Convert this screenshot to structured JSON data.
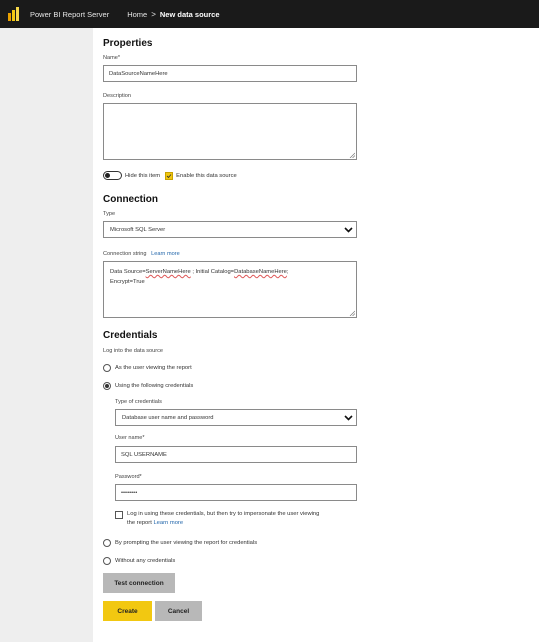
{
  "topbar": {
    "app_name": "Power BI Report Server",
    "home": "Home",
    "separator": ">",
    "current": "New data source"
  },
  "properties": {
    "heading": "Properties",
    "name_label": "Name*",
    "name_value": "DataSourceNameHere",
    "description_label": "Description",
    "description_value": "",
    "hide_item_label": "Hide this item",
    "enable_label": "Enable this data source",
    "hide_item_on": false,
    "enable_checked": true
  },
  "connection": {
    "heading": "Connection",
    "type_label": "Type",
    "type_value": "Microsoft SQL Server",
    "string_label": "Connection string",
    "learn_more": "Learn more",
    "string_parts": [
      {
        "text": "Data Source=",
        "squiggle": false
      },
      {
        "text": "ServerNameHere",
        "squiggle": true
      },
      {
        "text": " ; Initial Catalog=",
        "squiggle": false
      },
      {
        "text": "DatabaseNameHere",
        "squiggle": true
      },
      {
        "text": ";",
        "squiggle": false
      }
    ],
    "string_line2": "Encrypt=True"
  },
  "credentials": {
    "heading": "Credentials",
    "log_into_label": "Log into the data source",
    "as_user_label": "As the user viewing the report",
    "using_following_label": "Using the following credentials",
    "type_label": "Type of credentials",
    "type_value": "Database user name and password",
    "user_label": "User name*",
    "user_value": "SQL USERNAME",
    "password_label": "Password*",
    "password_value": "••••••••",
    "impersonate_line1": "Log in using these credentials, but then try to impersonate the user viewing",
    "impersonate_line2": "the report",
    "impersonate_learn_more": "Learn more",
    "prompting_label": "By prompting the user viewing the report for credentials",
    "without_label": "Without any credentials",
    "selected": "using_following"
  },
  "buttons": {
    "test_connection": "Test connection",
    "create": "Create",
    "cancel": "Cancel"
  },
  "colors": {
    "accent_yellow": "#f2c811",
    "topbar": "#1a1a1a",
    "link": "#2266aa"
  }
}
